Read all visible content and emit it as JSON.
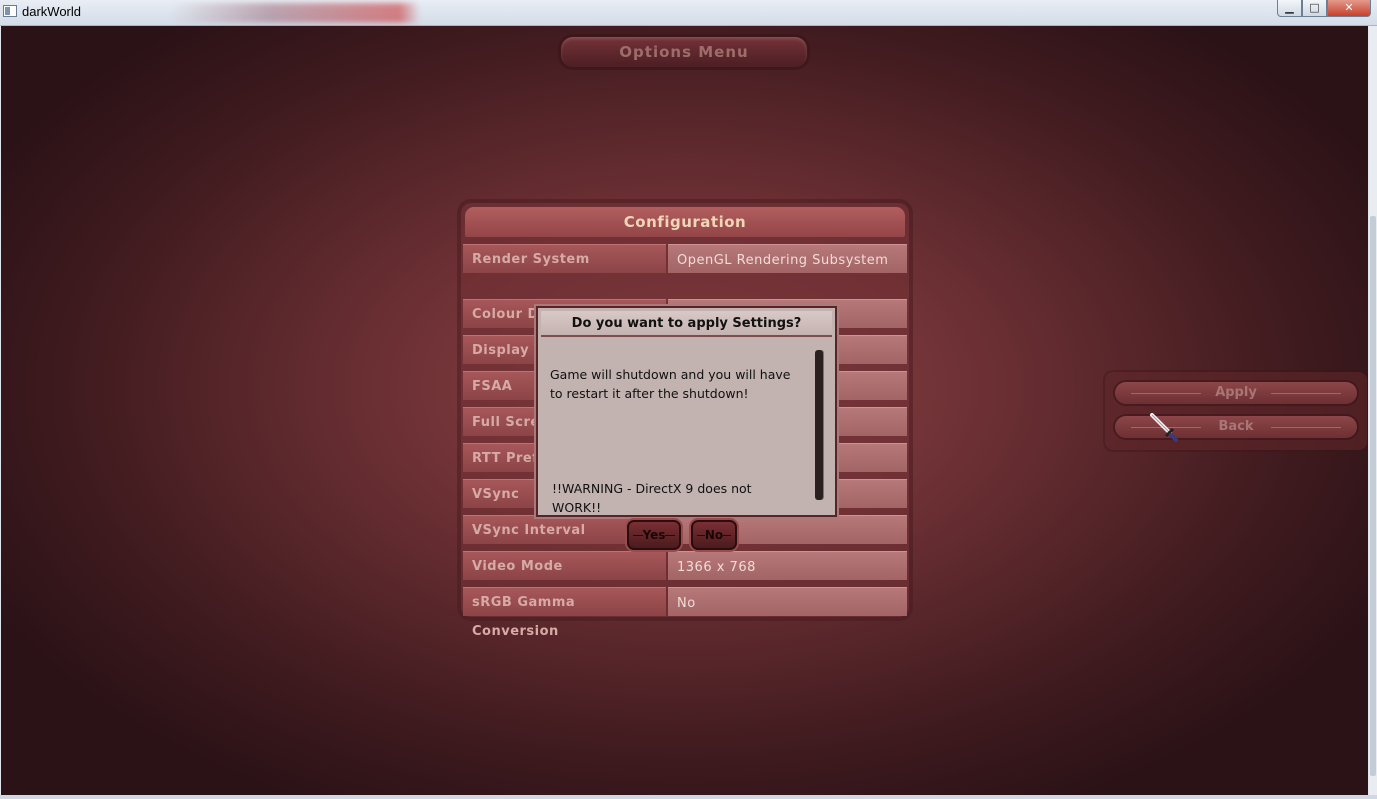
{
  "window": {
    "title": "darkWorld",
    "controls": {
      "minimize": "▁",
      "maximize": "□",
      "close": "✕"
    }
  },
  "game": {
    "menu_title": "Options Menu",
    "config": {
      "title": "Configuration",
      "rows": [
        {
          "label": "Render System",
          "value": "OpenGL Rendering Subsystem"
        },
        {
          "label": "Colour D",
          "value": ""
        },
        {
          "label": "Display F",
          "value": ""
        },
        {
          "label": "FSAA",
          "value": ""
        },
        {
          "label": "Full Scre",
          "value": ""
        },
        {
          "label": "RTT Pref",
          "value": ""
        },
        {
          "label": "VSync",
          "value": ""
        },
        {
          "label": "VSync Interval",
          "value": ""
        },
        {
          "label": "Video Mode",
          "value": "1366 x 768"
        },
        {
          "label": "sRGB Gamma Conversion",
          "value": "No"
        }
      ]
    },
    "side_buttons": {
      "apply": "Apply",
      "back": "Back"
    },
    "dialog": {
      "title": "Do you want to apply Settings?",
      "message": "Game will shutdown and you will have to restart it after the shutdown!",
      "warning": "!!WARNING - DirectX 9 does not WORK!!",
      "yes": "Yes",
      "no": "No"
    }
  },
  "colors": {
    "background": "#6a2f33",
    "panel_header": "#a65759",
    "dialog_bg": "#c2b2b0"
  }
}
